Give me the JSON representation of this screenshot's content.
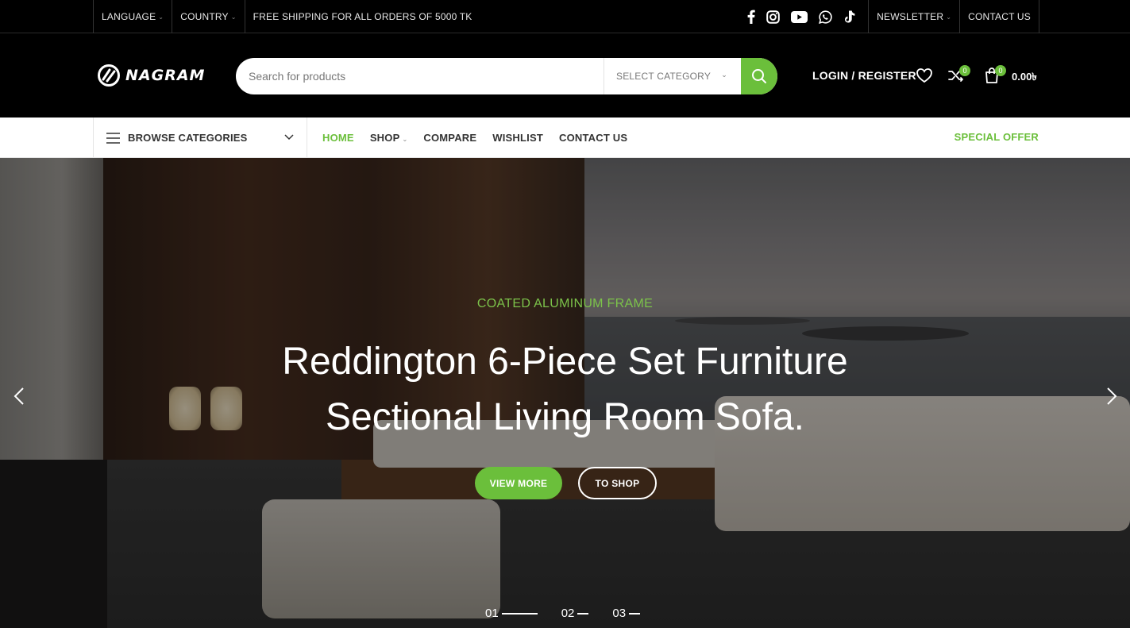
{
  "topbar": {
    "language": "LANGUAGE",
    "country": "COUNTRY",
    "shipping": "FREE SHIPPING FOR ALL ORDERS OF 5000 TK",
    "newsletter": "NEWSLETTER",
    "contact": "CONTACT US",
    "socials": [
      "facebook-icon",
      "instagram-icon",
      "youtube-icon",
      "whatsapp-icon",
      "tiktok-icon"
    ]
  },
  "header": {
    "logo": "NAGRAM",
    "search_placeholder": "Search for products",
    "category_label": "SELECT CATEGORY",
    "login": "LOGIN / REGISTER",
    "compare_count": "0",
    "cart_count": "0",
    "cart_total": "0.00৳"
  },
  "nav": {
    "browse_label": "BROWSE CATEGORIES",
    "items": [
      {
        "label": "HOME",
        "active": true
      },
      {
        "label": "SHOP"
      },
      {
        "label": "COMPARE"
      },
      {
        "label": "WISHLIST"
      },
      {
        "label": "CONTACT US"
      }
    ],
    "special_offer": "SPECIAL OFFER"
  },
  "hero": {
    "eyebrow": "COATED ALUMINUM FRAME",
    "title_line1": "Reddington 6-Piece Set Furniture",
    "title_line2": "Sectional Living Room Sofa.",
    "primary_button": "VIEW MORE",
    "secondary_button": "TO SHOP",
    "slides": [
      "01",
      "02",
      "03"
    ]
  },
  "colors": {
    "accent": "#6bbf3b",
    "header_bg": "#000000",
    "nav_bg": "#ffffff"
  }
}
